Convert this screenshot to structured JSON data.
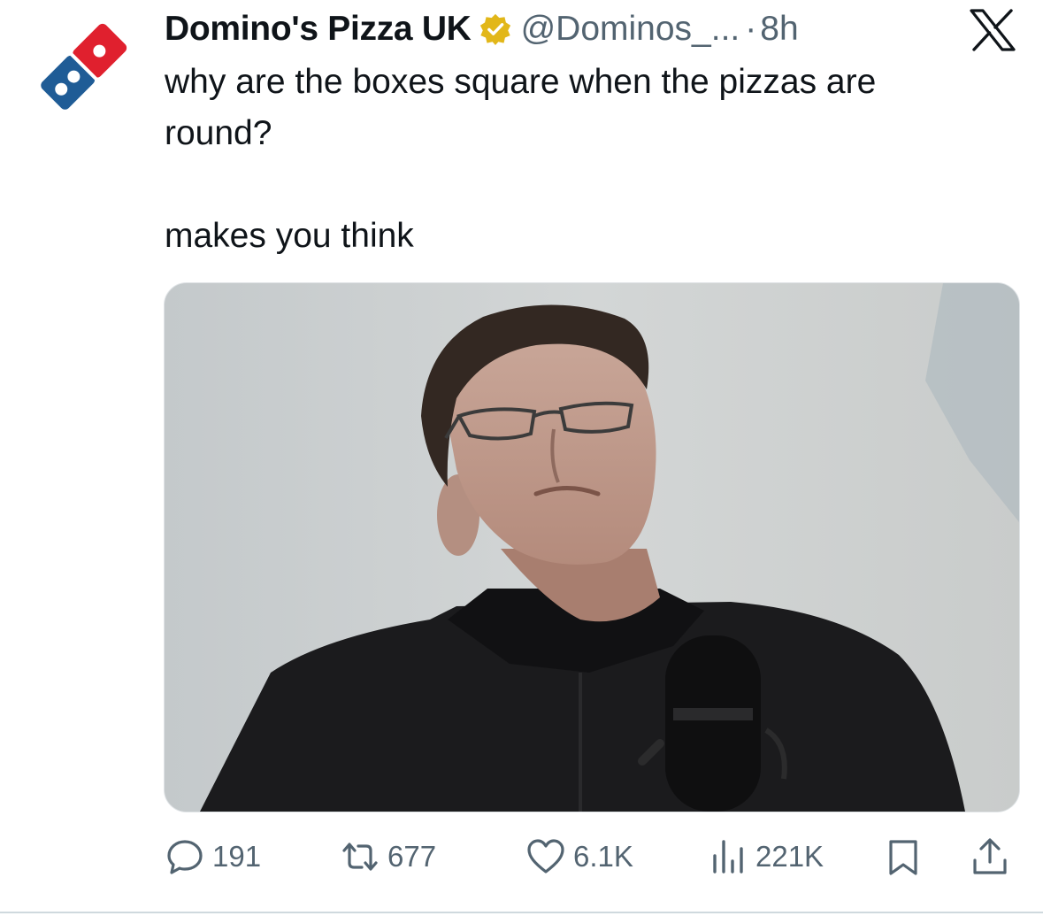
{
  "tweet": {
    "author_name": "Domino's Pizza UK",
    "handle": "@Dominos_...",
    "separator": "·",
    "time": "8h",
    "text": "why are the boxes square when the pizzas are\nround?\n\nmakes you think"
  },
  "icons": {
    "avatar": "dominos-logo",
    "verified": "verified-badge-icon",
    "platform": "x-logo-icon",
    "reply": "reply-icon",
    "retweet": "retweet-icon",
    "like": "heart-icon",
    "views": "views-icon",
    "bookmark": "bookmark-icon",
    "share": "share-icon"
  },
  "metrics": {
    "replies": "191",
    "retweets": "677",
    "likes": "6.1K",
    "views": "221K"
  },
  "colors": {
    "dominos_blue": "#1f5c96",
    "dominos_red": "#e0202e",
    "verified_gold": "#e2b719",
    "secondary_text": "#536471"
  }
}
